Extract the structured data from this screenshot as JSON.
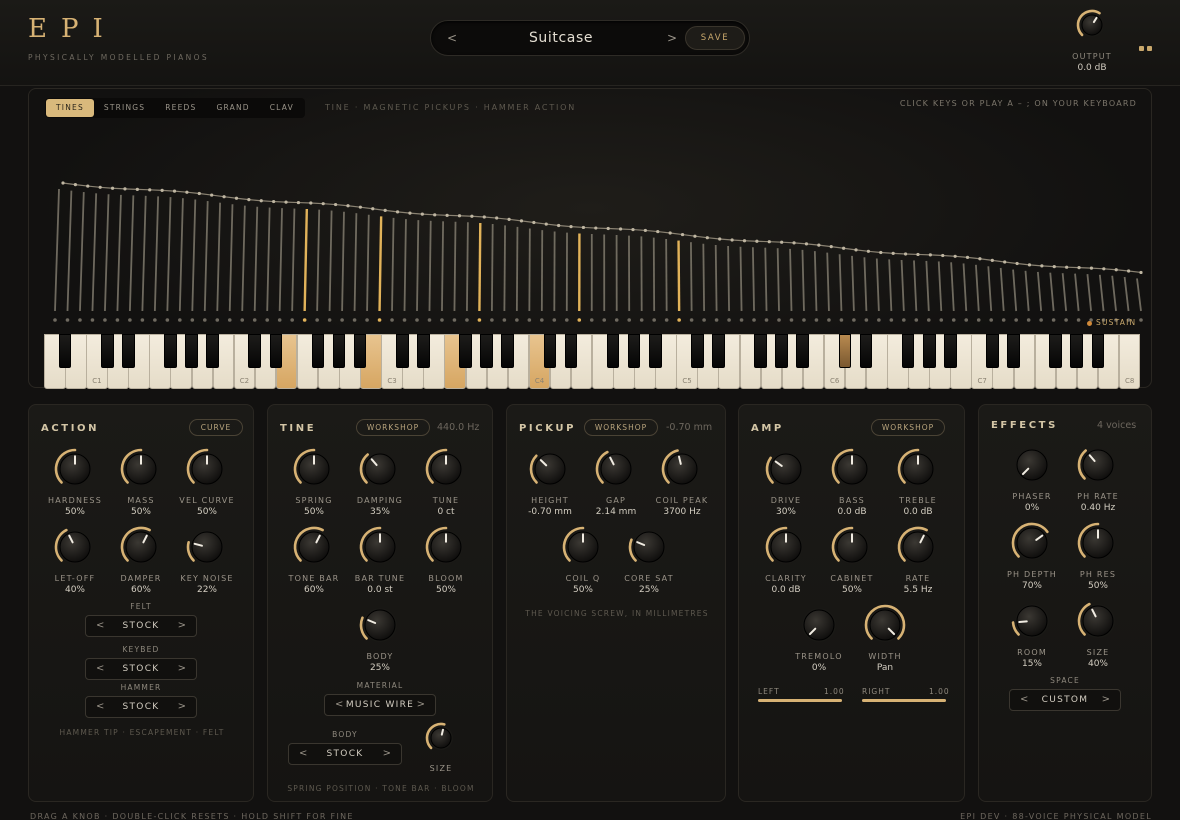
{
  "header": {
    "logo": "EPI",
    "subtitle": "PHYSICALLY MODELLED PIANOS",
    "preset_name": "Suitcase",
    "prev_glyph": "<",
    "next_glyph": ">",
    "save_label": "SAVE",
    "output_label": "OUTPUT",
    "output_value": "0.0 dB",
    "output_level": 0.62
  },
  "main": {
    "tabs": [
      "TINES",
      "STRINGS",
      "REEDS",
      "GRAND",
      "CLAV"
    ],
    "active_tab": "TINES",
    "model_desc": "TINE · MAGNETIC PICKUPS · HAMMER ACTION",
    "hint": "CLICK KEYS OR PLAY A – ; ON YOUR KEYBOARD",
    "sustain_label": "SUSTAIN",
    "octave_labels": [
      "C1",
      "C2",
      "C3",
      "C4",
      "C5",
      "C6",
      "C7",
      "C8"
    ],
    "lit_white_keys": [
      11,
      15,
      19,
      23
    ],
    "lit_black_keys": [
      26
    ],
    "lit_tines": [
      20,
      26,
      34,
      42,
      50
    ]
  },
  "action": {
    "title": "ACTION",
    "pill": "CURVE",
    "knobs": [
      {
        "label": "HARDNESS",
        "value": "50%",
        "level": 0.5
      },
      {
        "label": "MASS",
        "value": "50%",
        "level": 0.5
      },
      {
        "label": "VEL CURVE",
        "value": "50%",
        "level": 0.5
      },
      {
        "label": "LET-OFF",
        "value": "40%",
        "level": 0.4
      },
      {
        "label": "DAMPER",
        "value": "60%",
        "level": 0.6
      },
      {
        "label": "KEY NOISE",
        "value": "22%",
        "level": 0.22
      }
    ],
    "selectors": [
      {
        "label": "FELT",
        "value": "STOCK"
      },
      {
        "label": "KEYBED",
        "value": "STOCK"
      },
      {
        "label": "HAMMER",
        "value": "STOCK"
      }
    ],
    "footer": "HAMMER TIP · ESCAPEMENT · FELT"
  },
  "tine": {
    "title": "TINE",
    "pill": "WORKSHOP",
    "value": "440.0 Hz",
    "knobs": [
      {
        "label": "SPRING",
        "value": "50%",
        "level": 0.5
      },
      {
        "label": "DAMPING",
        "value": "35%",
        "level": 0.35
      },
      {
        "label": "TUNE",
        "value": "0 ct",
        "level": 0.5
      },
      {
        "label": "TONE BAR",
        "value": "60%",
        "level": 0.6
      },
      {
        "label": "BAR TUNE",
        "value": "0.0 st",
        "level": 0.5
      },
      {
        "label": "BLOOM",
        "value": "50%",
        "level": 0.5
      },
      {
        "label": "BODY",
        "value": "25%",
        "level": 0.25
      }
    ],
    "material_label": "MATERIAL",
    "material_value": "MUSIC WIRE",
    "body_label": "BODY",
    "body_value": "STOCK",
    "size_label": "SIZE",
    "size_level": 0.55,
    "footer": "SPRING POSITION · TONE BAR · BLOOM"
  },
  "pickup": {
    "title": "PICKUP",
    "pill": "WORKSHOP",
    "value": "-0.70 mm",
    "knobs": [
      {
        "label": "HEIGHT",
        "value": "-0.70 mm",
        "level": 0.33
      },
      {
        "label": "GAP",
        "value": "2.14 mm",
        "level": 0.4
      },
      {
        "label": "COIL PEAK",
        "value": "3700 Hz",
        "level": 0.45
      },
      {
        "label": "COIL Q",
        "value": "50%",
        "level": 0.5
      },
      {
        "label": "CORE SAT",
        "value": "25%",
        "level": 0.25
      }
    ],
    "footer": "THE VOICING SCREW, IN MILLIMETRES"
  },
  "amp": {
    "title": "AMP",
    "pill": "WORKSHOP",
    "knobs": [
      {
        "label": "DRIVE",
        "value": "30%",
        "level": 0.3
      },
      {
        "label": "BASS",
        "value": "0.0 dB",
        "level": 0.5
      },
      {
        "label": "TREBLE",
        "value": "0.0 dB",
        "level": 0.5
      },
      {
        "label": "CLARITY",
        "value": "0.0 dB",
        "level": 0.5
      },
      {
        "label": "CABINET",
        "value": "50%",
        "level": 0.5
      },
      {
        "label": "RATE",
        "value": "5.5 Hz",
        "level": 0.6
      },
      {
        "label": "TREMOLO",
        "value": "0%",
        "level": 0.0
      },
      {
        "label": "WIDTH",
        "value": "Pan",
        "level": 1.0
      }
    ],
    "left_label": "LEFT",
    "left_value": "1.00",
    "left_level": 1.0,
    "right_label": "RIGHT",
    "right_value": "1.00",
    "right_level": 1.0
  },
  "effects": {
    "title": "EFFECTS",
    "value": "4 voices",
    "knobs": [
      {
        "label": "PHASER",
        "value": "0%",
        "level": 0.0
      },
      {
        "label": "PH RATE",
        "value": "0.40 Hz",
        "level": 0.35
      },
      {
        "label": "PH DEPTH",
        "value": "70%",
        "level": 0.7
      },
      {
        "label": "PH RES",
        "value": "50%",
        "level": 0.5
      },
      {
        "label": "ROOM",
        "value": "15%",
        "level": 0.15
      },
      {
        "label": "SIZE",
        "value": "40%",
        "level": 0.4
      }
    ],
    "space_label": "SPACE",
    "space_value": "CUSTOM"
  },
  "footer": {
    "left": "DRAG A KNOB · DOUBLE-CLICK RESETS · HOLD SHIFT FOR FINE",
    "right": "EPI DEV · 88-VOICE PHYSICAL MODEL"
  },
  "colors": {
    "accent": "#d7b274",
    "background": "#121110",
    "panel": "#1b1a17",
    "key_lit": "#d6a662"
  }
}
